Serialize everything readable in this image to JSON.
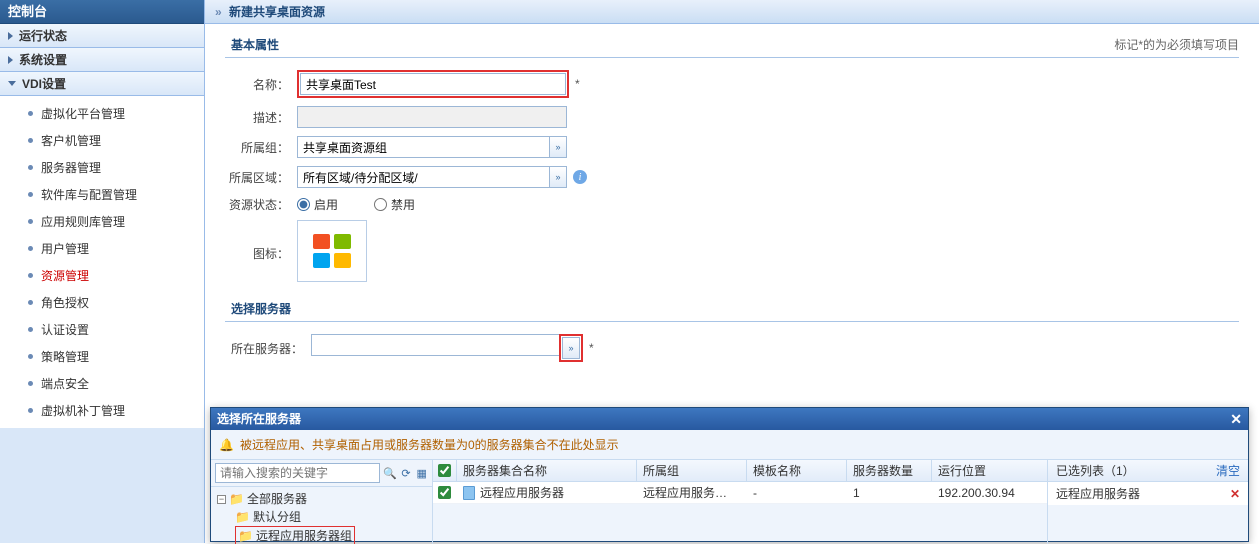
{
  "sidebar": {
    "title": "控制台",
    "sections": [
      {
        "label": "运行状态",
        "expanded": false
      },
      {
        "label": "系统设置",
        "expanded": false
      },
      {
        "label": "VDI设置",
        "expanded": true
      }
    ],
    "vdi_items": [
      "虚拟化平台管理",
      "客户机管理",
      "服务器管理",
      "软件库与配置管理",
      "应用规则库管理",
      "用户管理",
      "资源管理",
      "角色授权",
      "认证设置",
      "策略管理",
      "端点安全",
      "虚拟机补丁管理"
    ],
    "active_item": "资源管理"
  },
  "breadcrumb": {
    "prefix": "»",
    "title": "新建共享桌面资源"
  },
  "section_basic": {
    "title": "基本属性",
    "required_note": "标记*的为必须填写项目"
  },
  "form": {
    "name_label": "名称：",
    "name_value": "共享桌面Test",
    "desc_label": "描述：",
    "desc_value": "",
    "group_label": "所属组：",
    "group_value": "共享桌面资源组",
    "region_label": "所属区域：",
    "region_value": "所有区域/待分配区域/",
    "status_label": "资源状态：",
    "status_enable": "启用",
    "status_disable": "禁用",
    "icon_label": "图标："
  },
  "section_server": {
    "title": "选择服务器"
  },
  "server_field": {
    "label": "所在服务器：",
    "value": ""
  },
  "modal": {
    "title": "选择所在服务器",
    "warning": "被远程应用、共享桌面占用或服务器数量为0的服务器集合不在此处显示",
    "search_placeholder": "请输入搜索的关键字",
    "tree": {
      "root": "全部服务器",
      "children": [
        "默认分组",
        "远程应用服务器组"
      ],
      "selected": "远程应用服务器组"
    },
    "grid": {
      "headers": [
        "服务器集合名称",
        "所属组",
        "模板名称",
        "服务器数量",
        "运行位置"
      ],
      "rows": [
        {
          "name": "远程应用服务器",
          "group": "远程应用服务…",
          "template": "-",
          "count": "1",
          "location": "192.200.30.94",
          "checked": true
        }
      ]
    },
    "selected": {
      "title": "已选列表（1）",
      "clear": "清空",
      "items": [
        "远程应用服务器"
      ]
    }
  }
}
